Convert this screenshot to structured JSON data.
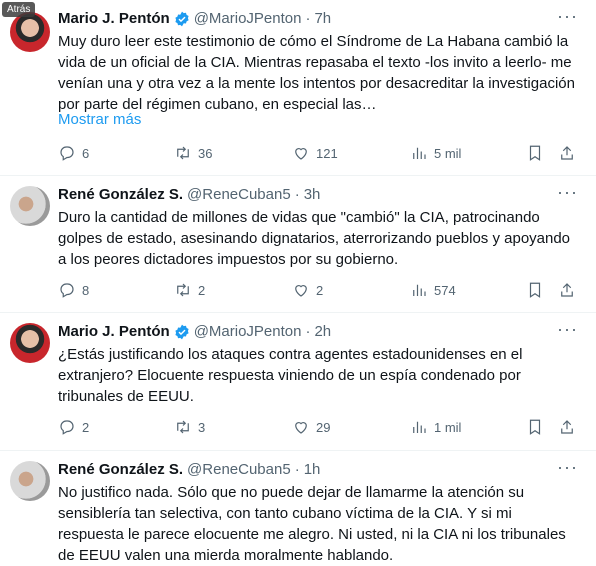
{
  "badge": "Atrás",
  "tweets": [
    {
      "name": "Mario J. Pentón",
      "handle": "@MarioJPenton",
      "time": "7h",
      "text": "Muy duro leer este testimonio de cómo el Síndrome de La Habana cambió la vida de un oficial de la CIA. Mientras repasaba el texto -los invito a leerlo- me venían una y otra vez a la mente los intentos por desacreditar la investigación por parte del régimen cubano, en especial las…",
      "show_more": "Mostrar más",
      "replies": "6",
      "retweets": "36",
      "likes": "121",
      "views": "5 mil"
    },
    {
      "name": "René González S.",
      "handle": "@ReneCuban5",
      "time": "3h",
      "text": "Duro la cantidad de millones de vidas que \"cambió\" la CIA, patrocinando golpes de estado, asesinando dignatarios, aterrorizando pueblos y apoyando a los peores dictadores impuestos por su gobierno.",
      "replies": "8",
      "retweets": "2",
      "likes": "2",
      "views": "574"
    },
    {
      "name": "Mario J. Pentón",
      "handle": "@MarioJPenton",
      "time": "2h",
      "text": "¿Estás justificando los ataques contra agentes estadounidenses en el extranjero? Elocuente respuesta viniendo de un espía condenado por tribunales de EEUU.",
      "replies": "2",
      "retweets": "3",
      "likes": "29",
      "views": "1 mil"
    },
    {
      "name": "René González S.",
      "handle": "@ReneCuban5",
      "time": "1h",
      "text": "No justifico nada. Sólo que no puede dejar de llamarme la atención su sensiblería tan selectiva, con tanto cubano víctima de la CIA. Y si mi respuesta le parece elocuente me alegro. Ni usted, ni la CIA ni los tribunales de EEUU valen una mierda moralmente hablando."
    }
  ],
  "colors": {
    "accent": "#1d9bf0",
    "muted": "#536471",
    "text": "#0f1419"
  }
}
